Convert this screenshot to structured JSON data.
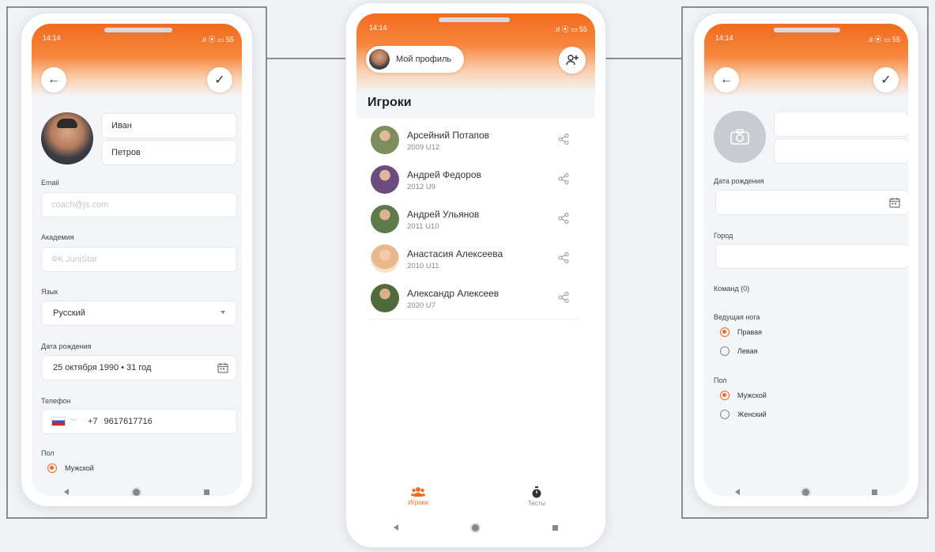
{
  "colors": {
    "accent": "#f26b1d",
    "bg": "#f1f2f6",
    "frame": "#8a8c90"
  },
  "left_phone": {
    "status": {
      "time": "14:14",
      "right": ".ıl ⦿ ▭ 55"
    },
    "back_icon": "←",
    "check_icon": "✓",
    "first_name": "Иван",
    "last_name": "Петров",
    "email": {
      "label": "Email",
      "placeholder": "coach@js.com"
    },
    "academy": {
      "label": "Академия",
      "placeholder": "ФК JuniStar"
    },
    "language": {
      "label": "Язык",
      "value": "Русский"
    },
    "birth_date": {
      "label": "Дата рождения",
      "value": "25 октября 1990 • 31 год"
    },
    "phone": {
      "label": "Телефон",
      "code": "+7",
      "number": "9617617716"
    },
    "gender": {
      "label": "Пол",
      "options": [
        {
          "label": "Мужской",
          "selected": true
        }
      ]
    }
  },
  "center_phone": {
    "status": {
      "time": "14:14",
      "right": ".ıl ⦿ ▭ 55"
    },
    "profile_button": "Мой профиль",
    "add_player_icon": "add-user-icon",
    "title": "Игроки",
    "players": [
      {
        "name": "Арсейний Потапов",
        "sub": "2009 U12",
        "avatar": "#7e8d5c"
      },
      {
        "name": "Андрей Федоров",
        "sub": "2012 U9",
        "avatar": "#6a4d7e"
      },
      {
        "name": "Андрей Ульянов",
        "sub": "2011 U10",
        "avatar": "#5d7a4a"
      },
      {
        "name": "Анастасия Алексеева",
        "sub": "2010 U11",
        "avatar": "#e8b88c"
      },
      {
        "name": "Александр Алексеев",
        "sub": "2020 U7",
        "avatar": "#4f6b3c"
      }
    ],
    "bottom_nav": [
      {
        "label": "Игроки",
        "active": true
      },
      {
        "label": "Тесты",
        "active": false
      }
    ]
  },
  "right_phone": {
    "status": {
      "time": "14:14",
      "right": ".ıl ⦿ ▭ 55"
    },
    "birth_date": {
      "label": "Дата рождения"
    },
    "city": {
      "label": "Город"
    },
    "team": {
      "label": "Команд (0)"
    },
    "leading_foot": {
      "label": "Ведущая нога",
      "options": [
        {
          "label": "Правая",
          "selected": true
        },
        {
          "label": "Левая",
          "selected": false
        }
      ]
    },
    "gender": {
      "label": "Пол",
      "options": [
        {
          "label": "Мужской",
          "selected": true
        },
        {
          "label": "Женский",
          "selected": false
        }
      ]
    }
  }
}
